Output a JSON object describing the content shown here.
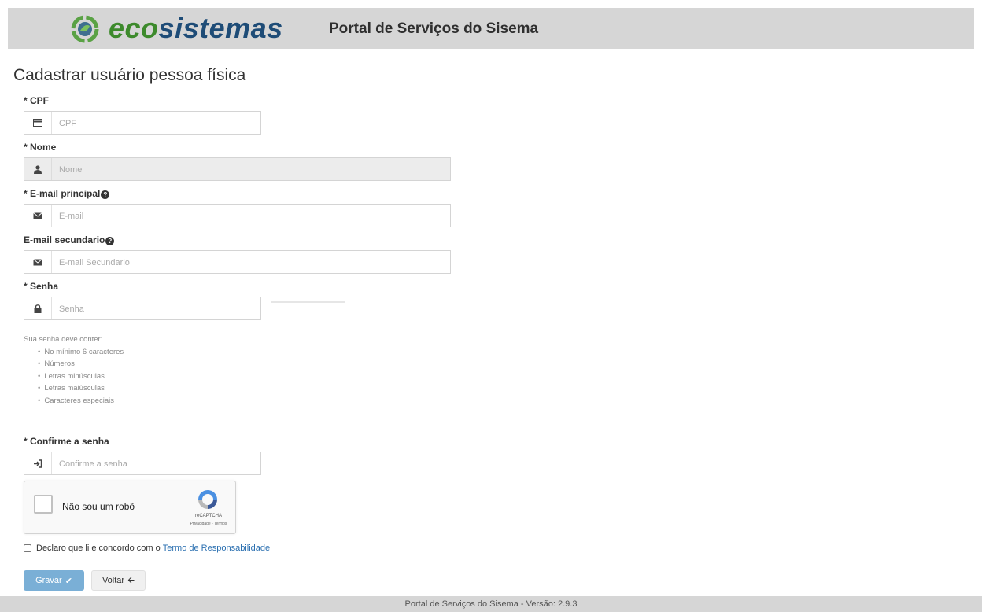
{
  "header": {
    "brand_eco": "eco",
    "brand_sistemas": "sistemas",
    "portal_title": "Portal de Serviços do Sisema",
    "brand_colors": {
      "eco": "#3d8a2c",
      "sistemas": "#1e4c77"
    }
  },
  "page": {
    "title": "Cadastrar usuário pessoa física"
  },
  "form": {
    "cpf": {
      "label": "* CPF",
      "placeholder": "CPF",
      "value": "",
      "icon": "id-card-icon"
    },
    "nome": {
      "label": "* Nome",
      "placeholder": "Nome",
      "value": "",
      "disabled": true,
      "icon": "user-icon"
    },
    "email_principal": {
      "label": "* E-mail principal",
      "placeholder": "E-mail",
      "value": "",
      "icon": "envelope-icon"
    },
    "email_secundario": {
      "label": "E-mail secundario",
      "placeholder": "E-mail Secundario",
      "value": "",
      "icon": "envelope-icon"
    },
    "senha": {
      "label": "* Senha",
      "placeholder": "Senha",
      "value": "",
      "icon": "lock-icon"
    },
    "password_hint": {
      "intro": "Sua senha deve conter:",
      "rules": [
        "No mínimo 6 caracteres",
        "Números",
        "Letras minúsculas",
        "Letras maiúsculas",
        "Caracteres especiais"
      ]
    },
    "confirme_senha": {
      "label": "* Confirme a senha",
      "placeholder": "Confirme a senha",
      "value": "",
      "icon": "sign-in-icon"
    },
    "captcha": {
      "label": "Não sou um robô",
      "brand": "reCAPTCHA",
      "terms": "Privacidade - Termos",
      "checked": false
    },
    "terms": {
      "text": "Declaro que li e concordo com o",
      "link": "Termo de Responsabilidade",
      "checked": false
    }
  },
  "buttons": {
    "save": {
      "label": "Gravar",
      "color": "#7aafd6"
    },
    "back": {
      "label": "Voltar"
    }
  },
  "footer": {
    "text": "Portal de Serviços do Sisema - Versão: 2.9.3"
  }
}
